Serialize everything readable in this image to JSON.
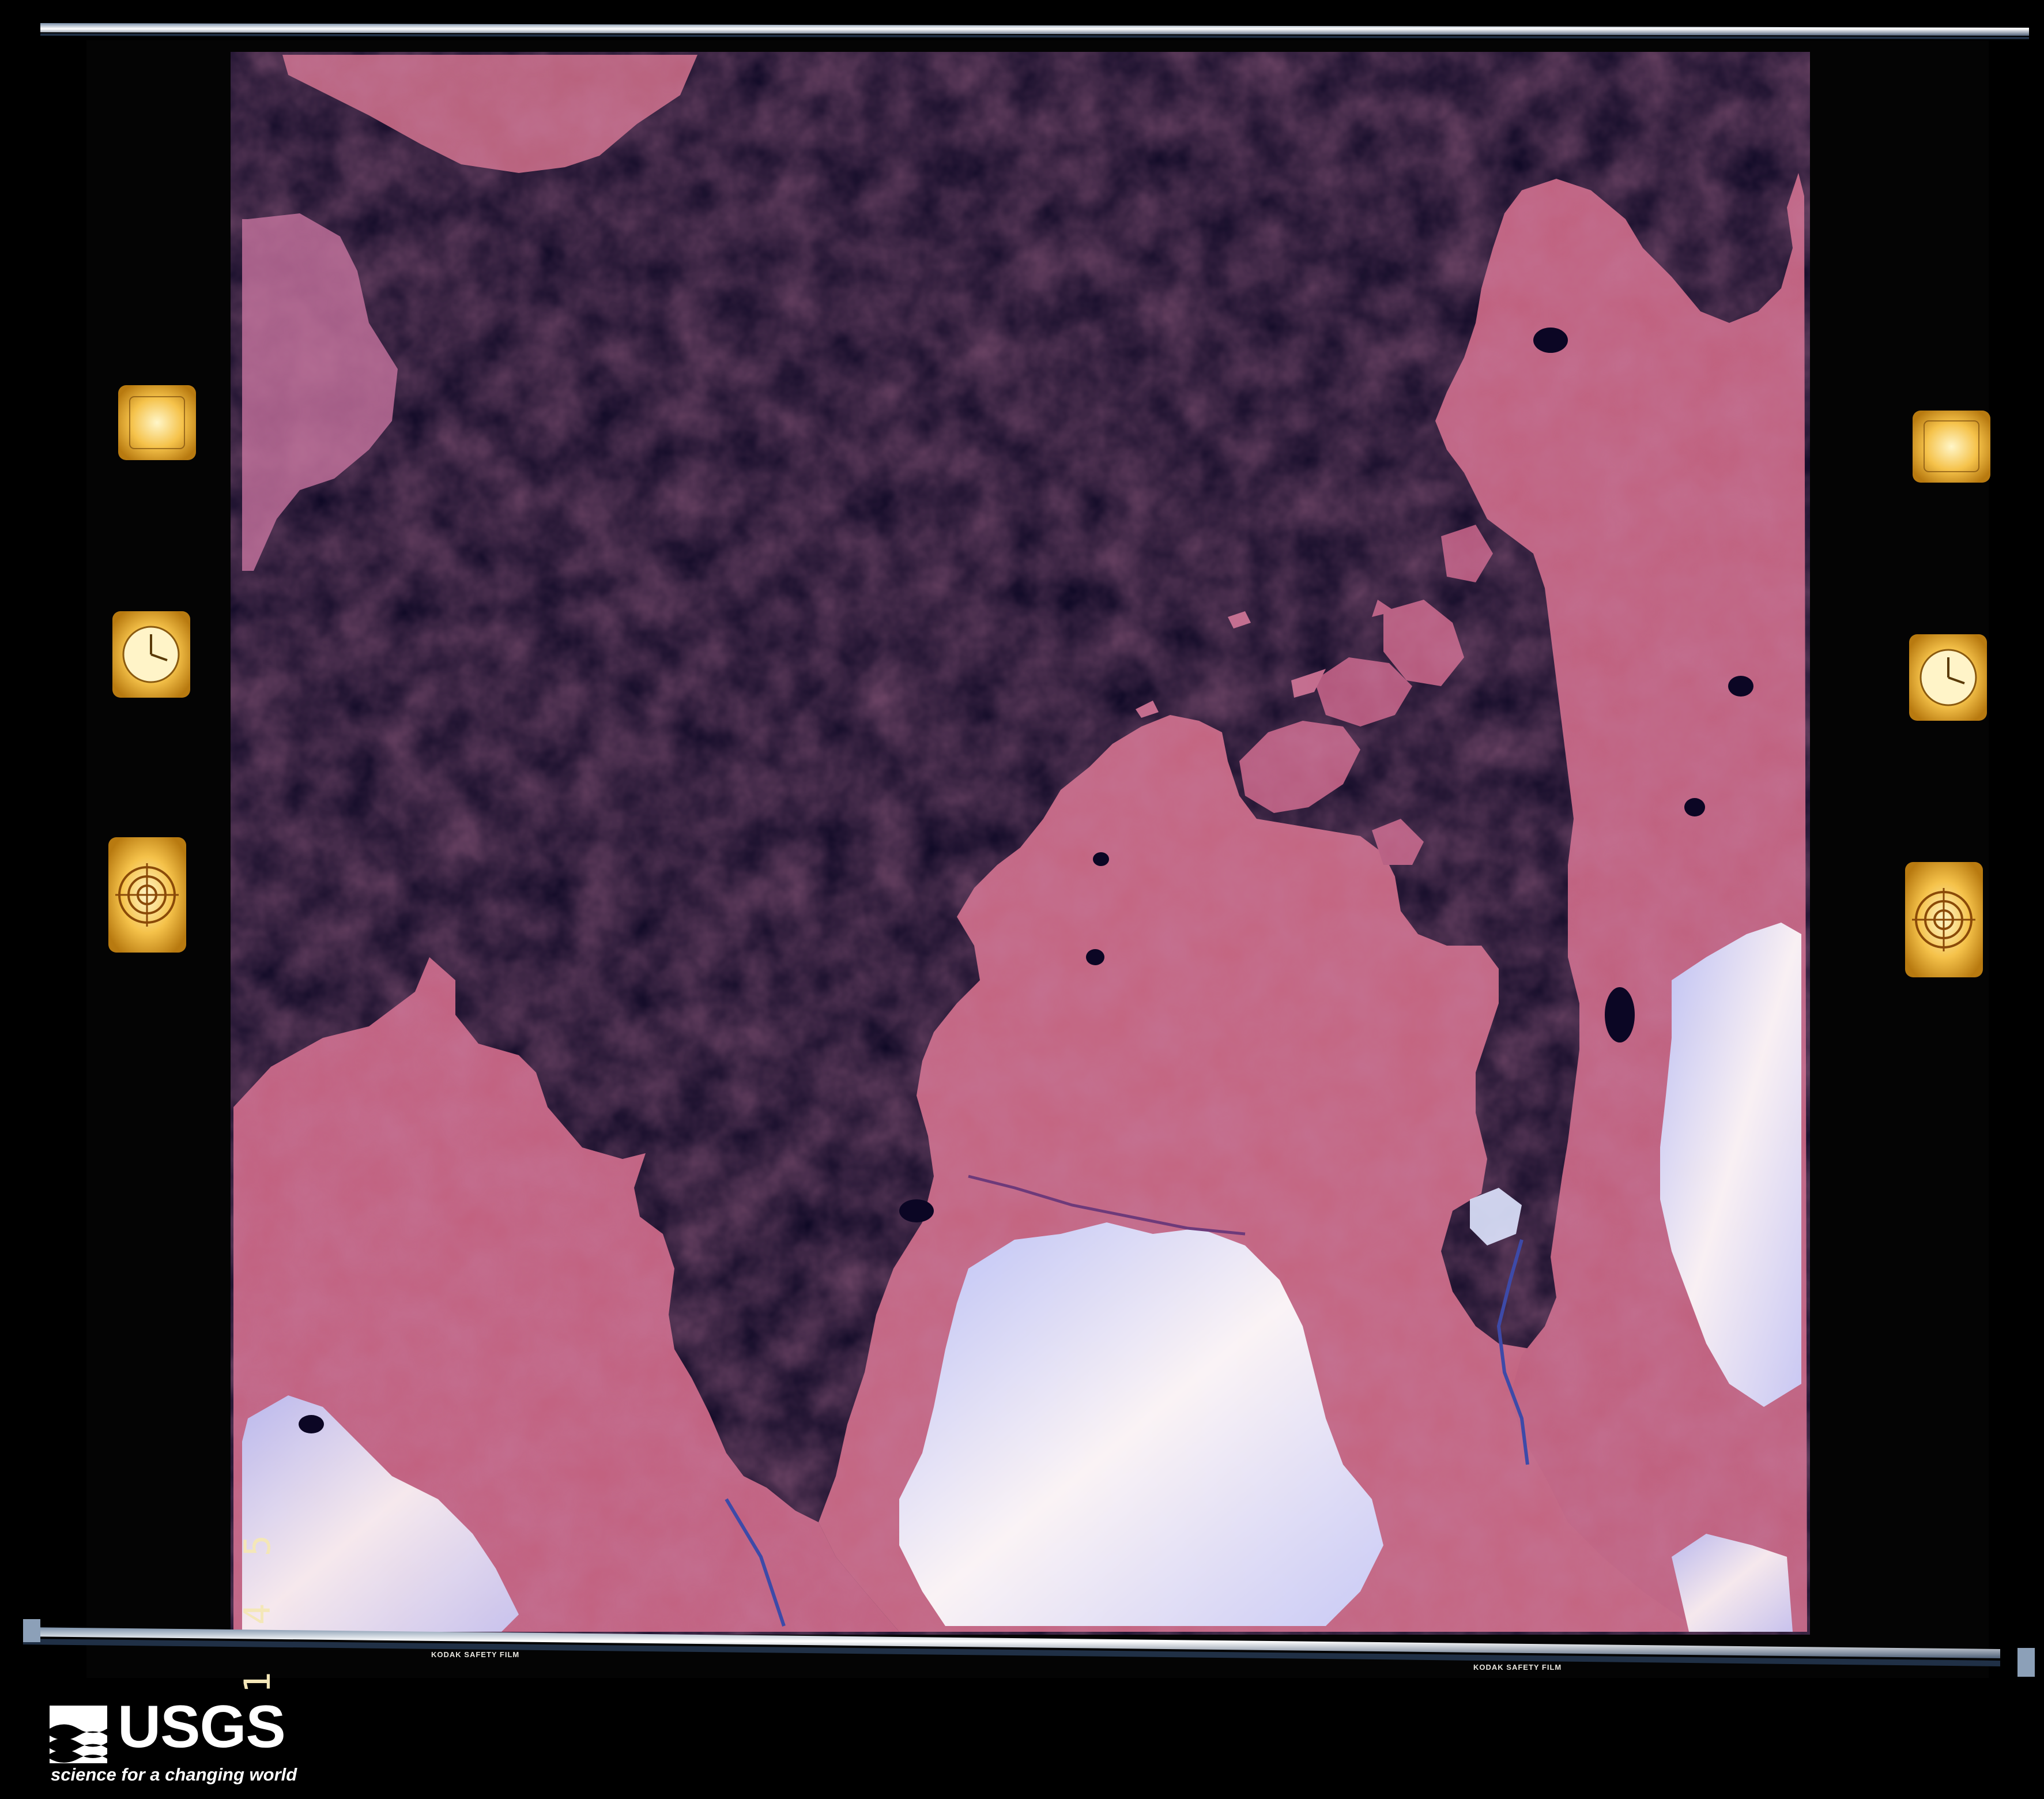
{
  "film": {
    "edge_label_1": "KODAK SAFETY FILM",
    "edge_label_2": "KODAK SAFETY FILM",
    "frame_id": "1 4 5"
  },
  "logo": {
    "name": "USGS",
    "tagline": "science for a changing world"
  },
  "colors": {
    "water": "#070420",
    "land": "#c2607e",
    "land_dark": "#8a4062",
    "snow": "#eef0ff",
    "film_base": "#050505",
    "sprocket_light": "#f5c24a"
  }
}
